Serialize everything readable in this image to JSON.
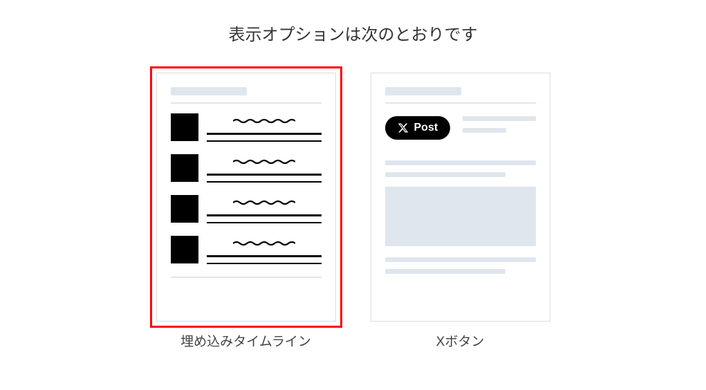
{
  "heading": "表示オプションは次のとおりです",
  "options": {
    "timeline": {
      "label": "埋め込みタイムライン"
    },
    "xbutton": {
      "label": "Xボタン",
      "pill_text": "Post"
    }
  }
}
